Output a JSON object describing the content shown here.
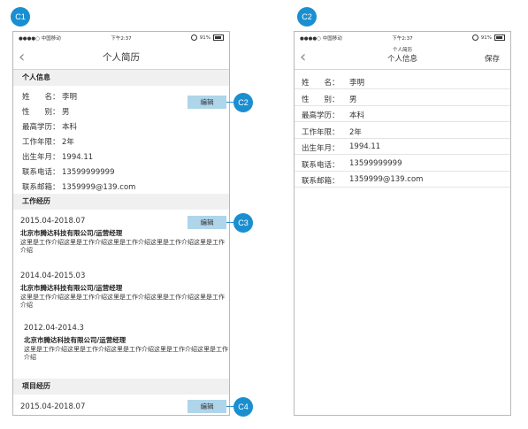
{
  "markers": {
    "c1": "C1",
    "c2": "C2",
    "c3": "C3",
    "c4": "C4",
    "c2_right": "C2"
  },
  "status": {
    "carrier": "●●●●○ 中国移动",
    "time": "下午2:37",
    "battery": "91%"
  },
  "left": {
    "title": "个人简历",
    "personal_title": "个人信息",
    "personal": [
      {
        "k": "姓　　名：",
        "v": "李明"
      },
      {
        "k": "性　　别：",
        "v": "男"
      },
      {
        "k": "最高学历：",
        "v": "本科"
      },
      {
        "k": "工作年限：",
        "v": "2年"
      },
      {
        "k": "出生年月：",
        "v": "1994.11"
      },
      {
        "k": "联系电话：",
        "v": "13599999999"
      },
      {
        "k": "联系邮箱：",
        "v": "1359999@139.com"
      }
    ],
    "edit_label": "编辑",
    "work_title": "工作经历",
    "work": [
      {
        "date": "2015.04-2018.07",
        "company": "北京市腾达科技有限公司/运营经理",
        "desc": "这里是工作介绍这里是工作介绍这里是工作介绍这里是工作介绍这里是工作介绍"
      },
      {
        "date": "2014.04-2015.03",
        "company": "北京市腾达科技有限公司/运营经理",
        "desc": "这里是工作介绍这里是工作介绍这里是工作介绍这里是工作介绍这里是工作介绍"
      },
      {
        "date": "2012.04-2014.3",
        "company": "北京市腾达科技有限公司/运营经理",
        "desc": "这里是工作介绍这里是工作介绍这里是工作介绍这里是工作介绍这里是工作介绍"
      }
    ],
    "project_title": "项目经历",
    "project_date": "2015.04-2018.07"
  },
  "right": {
    "subtitle": "个人简历",
    "title": "个人信息",
    "save": "保存",
    "fields": [
      {
        "k": "姓　　名：",
        "v": "李明"
      },
      {
        "k": "性　　别：",
        "v": "男"
      },
      {
        "k": "最高学历：",
        "v": "本科"
      },
      {
        "k": "工作年限：",
        "v": "2年"
      },
      {
        "k": "出生年月：",
        "v": "1994.11"
      },
      {
        "k": "联系电话：",
        "v": "13599999999"
      },
      {
        "k": "联系邮箱：",
        "v": "1359999@139.com"
      }
    ]
  },
  "colors": {
    "accent": "#1a8fd0",
    "edit_bg": "#aed5ea",
    "section_bg": "#f0f0f0"
  }
}
